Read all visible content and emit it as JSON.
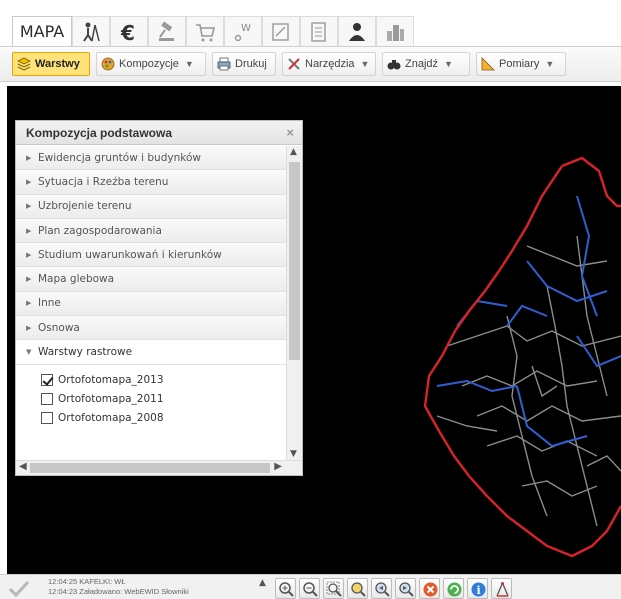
{
  "tabs": {
    "main_label": "MAPA",
    "icons": [
      "survey-person-icon",
      "euro-icon",
      "gavel-icon",
      "cart-icon",
      "water-meter-icon",
      "edit-form-icon",
      "document-list-icon",
      "users-icon",
      "buildings-icon"
    ]
  },
  "toolbar": {
    "layers_label": "Warstwy",
    "compositions_label": "Kompozycje",
    "print_label": "Drukuj",
    "tools_label": "Narzędzia",
    "find_label": "Znajdź",
    "measure_label": "Pomiary"
  },
  "panel": {
    "title": "Kompozycja podstawowa",
    "close_glyph": "×",
    "groups": [
      {
        "label": "Ewidencja gruntów i budynków"
      },
      {
        "label": "Sytuacja i Rzeźba terenu"
      },
      {
        "label": "Uzbrojenie terenu"
      },
      {
        "label": "Plan zagospodarowania"
      },
      {
        "label": "Studium uwarunkowań i kierunków"
      },
      {
        "label": "Mapa glebowa"
      },
      {
        "label": "Inne"
      },
      {
        "label": "Osnowa"
      }
    ],
    "open_group": {
      "label": "Warstwy rastrowe",
      "layers": [
        {
          "label": "Ortofotomapa_2013",
          "checked": true
        },
        {
          "label": "Ortofotomapa_2011",
          "checked": false
        },
        {
          "label": "Ortofotomapa_2008",
          "checked": false
        }
      ]
    }
  },
  "status": {
    "line1": "12:04:25 KAFELKI: WŁ",
    "line2": "12:04:23 Załadowano: WebEWID Słowniki"
  },
  "colors": {
    "toolbar_active": "#ffe27a",
    "map_background": "#000000",
    "arrow": "#e00000",
    "boundary_red": "#d8232a",
    "boundary_blue": "#2f5fd0"
  }
}
